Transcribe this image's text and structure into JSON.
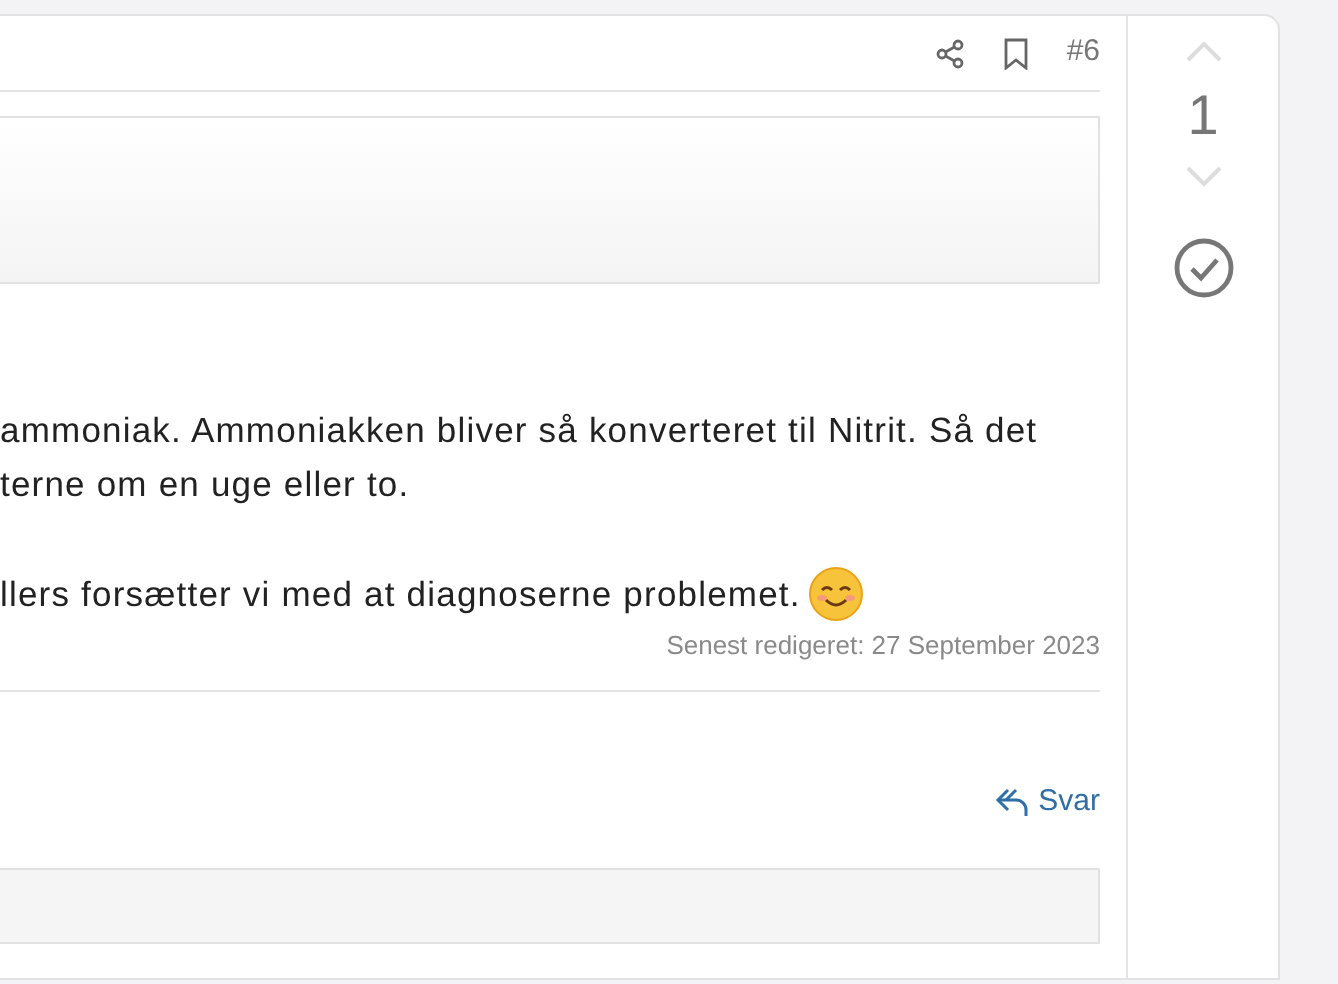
{
  "post": {
    "number": "#6",
    "paragraphs": [
      {
        "lines": [
          "ammoniak. Ammoniakken bliver så konverteret til Nitrit. Så det",
          "terne om en uge eller to."
        ],
        "smiley": false
      },
      {
        "lines": [
          "llers forsætter vi med at diagnoserne problemet."
        ],
        "smiley": true
      }
    ],
    "edited": "Senest redigeret: 27 September 2023",
    "reply": "Svar"
  },
  "votes": {
    "score": "1"
  }
}
